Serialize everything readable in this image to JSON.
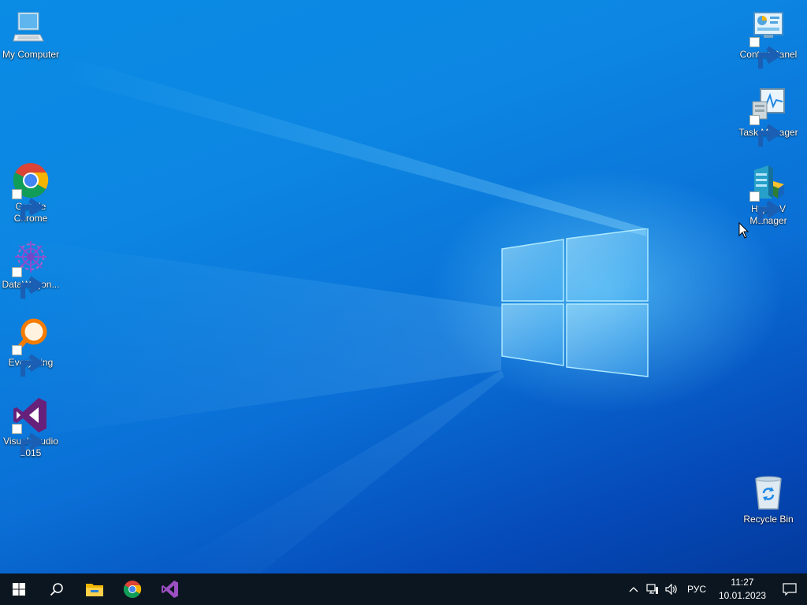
{
  "desktop": {
    "left_icons": [
      {
        "label": "My Computer",
        "icon": "computer-icon",
        "shortcut": false
      },
      {
        "label": "Google Chrome",
        "icon": "chrome-icon",
        "shortcut": true
      },
      {
        "label": "DataWagon...",
        "icon": "datawagon-icon",
        "shortcut": true
      },
      {
        "label": "Everything",
        "icon": "everything-search-icon",
        "shortcut": true
      },
      {
        "label": "Visual Studio 2015",
        "icon": "visual-studio-icon",
        "shortcut": true
      }
    ],
    "right_icons": [
      {
        "label": "Control Panel",
        "icon": "control-panel-icon",
        "shortcut": true
      },
      {
        "label": "Task Manager",
        "icon": "task-manager-icon",
        "shortcut": true
      },
      {
        "label": "Hyper-V Manager",
        "icon": "hyper-v-manager-icon",
        "shortcut": true
      },
      {
        "label": "Recycle Bin",
        "icon": "recycle-bin-icon",
        "shortcut": false
      }
    ]
  },
  "taskbar": {
    "start": "windows-start-icon",
    "search": "search-icon",
    "pinned": [
      "file-explorer-icon",
      "chrome-icon",
      "visual-studio-icon"
    ],
    "tray": {
      "chevron": "chevron-up-icon",
      "network": "network-icon",
      "volume": "volume-icon",
      "language": "РУС",
      "time": "11:27",
      "date": "10.01.2023",
      "notifications": "action-center-icon"
    }
  },
  "colors": {
    "desktop_bg": "#0a7fe0",
    "taskbar_bg": "#0b1620",
    "vs_purple": "#68217a"
  }
}
